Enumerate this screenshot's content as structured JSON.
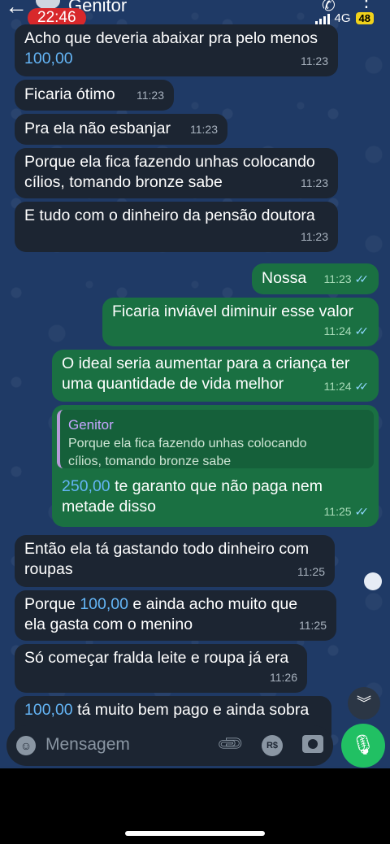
{
  "status_bar": {
    "time": "22:46",
    "network": "4G",
    "battery": "48"
  },
  "header": {
    "contact_name": "Genitor"
  },
  "messages": [
    {
      "dir": "in",
      "text_a": "Acho que deveria abaixar pra pelo menos",
      "amount": "100,00",
      "time": "11:23"
    },
    {
      "dir": "in",
      "text": "Ficaria ótimo",
      "time": "11:23"
    },
    {
      "dir": "in",
      "text": "Pra ela não esbanjar",
      "time": "11:23"
    },
    {
      "dir": "in",
      "text_a": "Porque ela fica fazendo unhas colocando",
      "text_b": "cílios, tomando bronze sabe",
      "time": "11:23"
    },
    {
      "dir": "in",
      "text": "E tudo com o dinheiro da pensão doutora",
      "time": "11:23"
    },
    {
      "dir": "out",
      "text": "Nossa",
      "time": "11:23"
    },
    {
      "dir": "out",
      "text": "Ficaria inviável diminuir esse valor",
      "time": "11:24"
    },
    {
      "dir": "out",
      "text_a": "O ideal seria aumentar para a criança ter",
      "text_b": "uma quantidade de vida melhor",
      "time": "11:24"
    },
    {
      "dir": "out",
      "quote_name": "Genitor",
      "quote_a": "Porque ela fica fazendo unhas colocando",
      "quote_b": "cílios, tomando bronze sabe",
      "amount": "250,00",
      "text_a": " te garanto que não paga nem",
      "text_b": "metade disso",
      "time": "11:25"
    },
    {
      "dir": "in",
      "text_a": "Então ela tá gastando todo dinheiro com",
      "text_b": "roupas",
      "time": "11:25"
    },
    {
      "dir": "in",
      "text_pre": "Porque ",
      "amount": "100,00",
      "text_a": " e ainda acho muito que",
      "text_b": "ela gasta com o menino",
      "time": "11:25"
    },
    {
      "dir": "in",
      "text": "Só começar fralda leite e roupa já era",
      "time": "11:26"
    },
    {
      "dir": "in",
      "amount": "100,00",
      "text_a": " tá muito bem pago e ainda sobra"
    }
  ],
  "input": {
    "placeholder": "Mensagem"
  },
  "icons": {
    "back": "arrow-left-icon",
    "call": "phone-icon",
    "menu": "more-vertical-icon",
    "emoji": "emoji-icon",
    "attach": "paperclip-icon",
    "money": "money-icon",
    "camera": "camera-icon",
    "mic": "microphone-icon",
    "scroll": "chevron-double-down-icon"
  },
  "colors": {
    "incoming": "#1c2532",
    "outgoing": "#1a7042",
    "accent": "#21c063",
    "background": "#1f3a66",
    "time_pill": "#d8282b",
    "amount": "#64b5f6"
  }
}
